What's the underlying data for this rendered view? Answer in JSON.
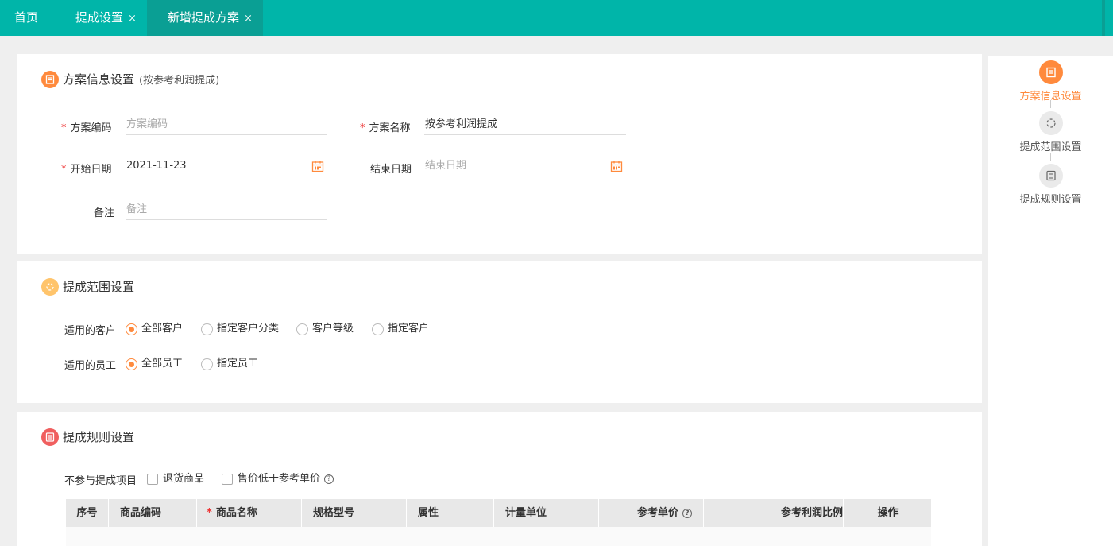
{
  "tabs": [
    {
      "label": "首页"
    },
    {
      "label": "提成设置",
      "close": "×"
    },
    {
      "label": "新增提成方案",
      "close": "×"
    }
  ],
  "colors": {
    "brand": "#00b5a9",
    "accent": "#ff8a3d",
    "required": "#ee3333"
  },
  "section1": {
    "title": "方案信息设置",
    "subtitle": "(按参考利润提成)",
    "icon": "document-icon",
    "code_label": "方案编码",
    "code_placeholder": "方案编码",
    "name_label": "方案名称",
    "name_value": "按参考利润提成",
    "start_label": "开始日期",
    "start_value": "2021-11-23",
    "end_label": "结束日期",
    "end_placeholder": "结束日期",
    "remark_label": "备注",
    "remark_placeholder": "备注"
  },
  "section2": {
    "title": "提成范围设置",
    "icon": "circle-dots-icon",
    "customer_label": "适用的客户",
    "customer_options": [
      "全部客户",
      "指定客户分类",
      "客户等级",
      "指定客户"
    ],
    "customer_selected": "全部客户",
    "employee_label": "适用的员工",
    "employee_options": [
      "全部员工",
      "指定员工"
    ],
    "employee_selected": "全部员工"
  },
  "section3": {
    "title": "提成规则设置",
    "icon": "list-icon",
    "exclude_label": "不参与提成项目",
    "exclude_options": [
      "退货商品",
      "售价低于参考单价"
    ],
    "columns": [
      "序号",
      "商品编码",
      "商品名称",
      "规格型号",
      "属性",
      "计量单位",
      "参考单价",
      "参考利润比例",
      "操作"
    ]
  },
  "steps": [
    {
      "label": "方案信息设置",
      "active": true
    },
    {
      "label": "提成范围设置",
      "active": false
    },
    {
      "label": "提成规则设置",
      "active": false
    }
  ]
}
